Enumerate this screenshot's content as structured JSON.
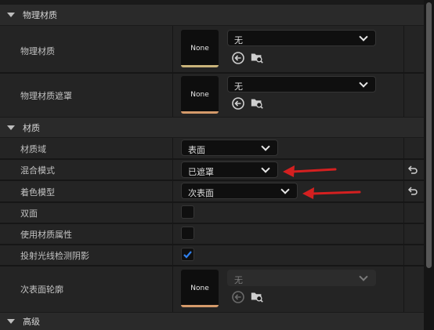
{
  "sections": {
    "physical_material": "物理材质",
    "material": "材质",
    "advanced": "高级"
  },
  "rows": {
    "phys_material": {
      "label": "物理材质",
      "thumb": "None",
      "value": "无"
    },
    "phys_mask": {
      "label": "物理材质遮罩",
      "thumb": "None",
      "value": "无"
    },
    "material_domain": {
      "label": "材质域",
      "value": "表面"
    },
    "blend_mode": {
      "label": "混合模式",
      "value": "已遮罩"
    },
    "shading_model": {
      "label": "着色模型",
      "value": "次表面"
    },
    "two_sided": {
      "label": "双面",
      "checked": false
    },
    "use_material_attributes": {
      "label": "使用材质属性",
      "checked": false
    },
    "cast_ray_traced_shadows": {
      "label": "投射光线检测阴影",
      "checked": true
    },
    "subsurface_profile": {
      "label": "次表面轮廓",
      "thumb": "None",
      "value": "无"
    }
  },
  "colors": {
    "accent_checkbox": "#2f80ed",
    "annotation_arrow": "#d42020",
    "thumb_bar_default": "#c9b37a",
    "thumb_bar_mask": "#d49a6a"
  }
}
